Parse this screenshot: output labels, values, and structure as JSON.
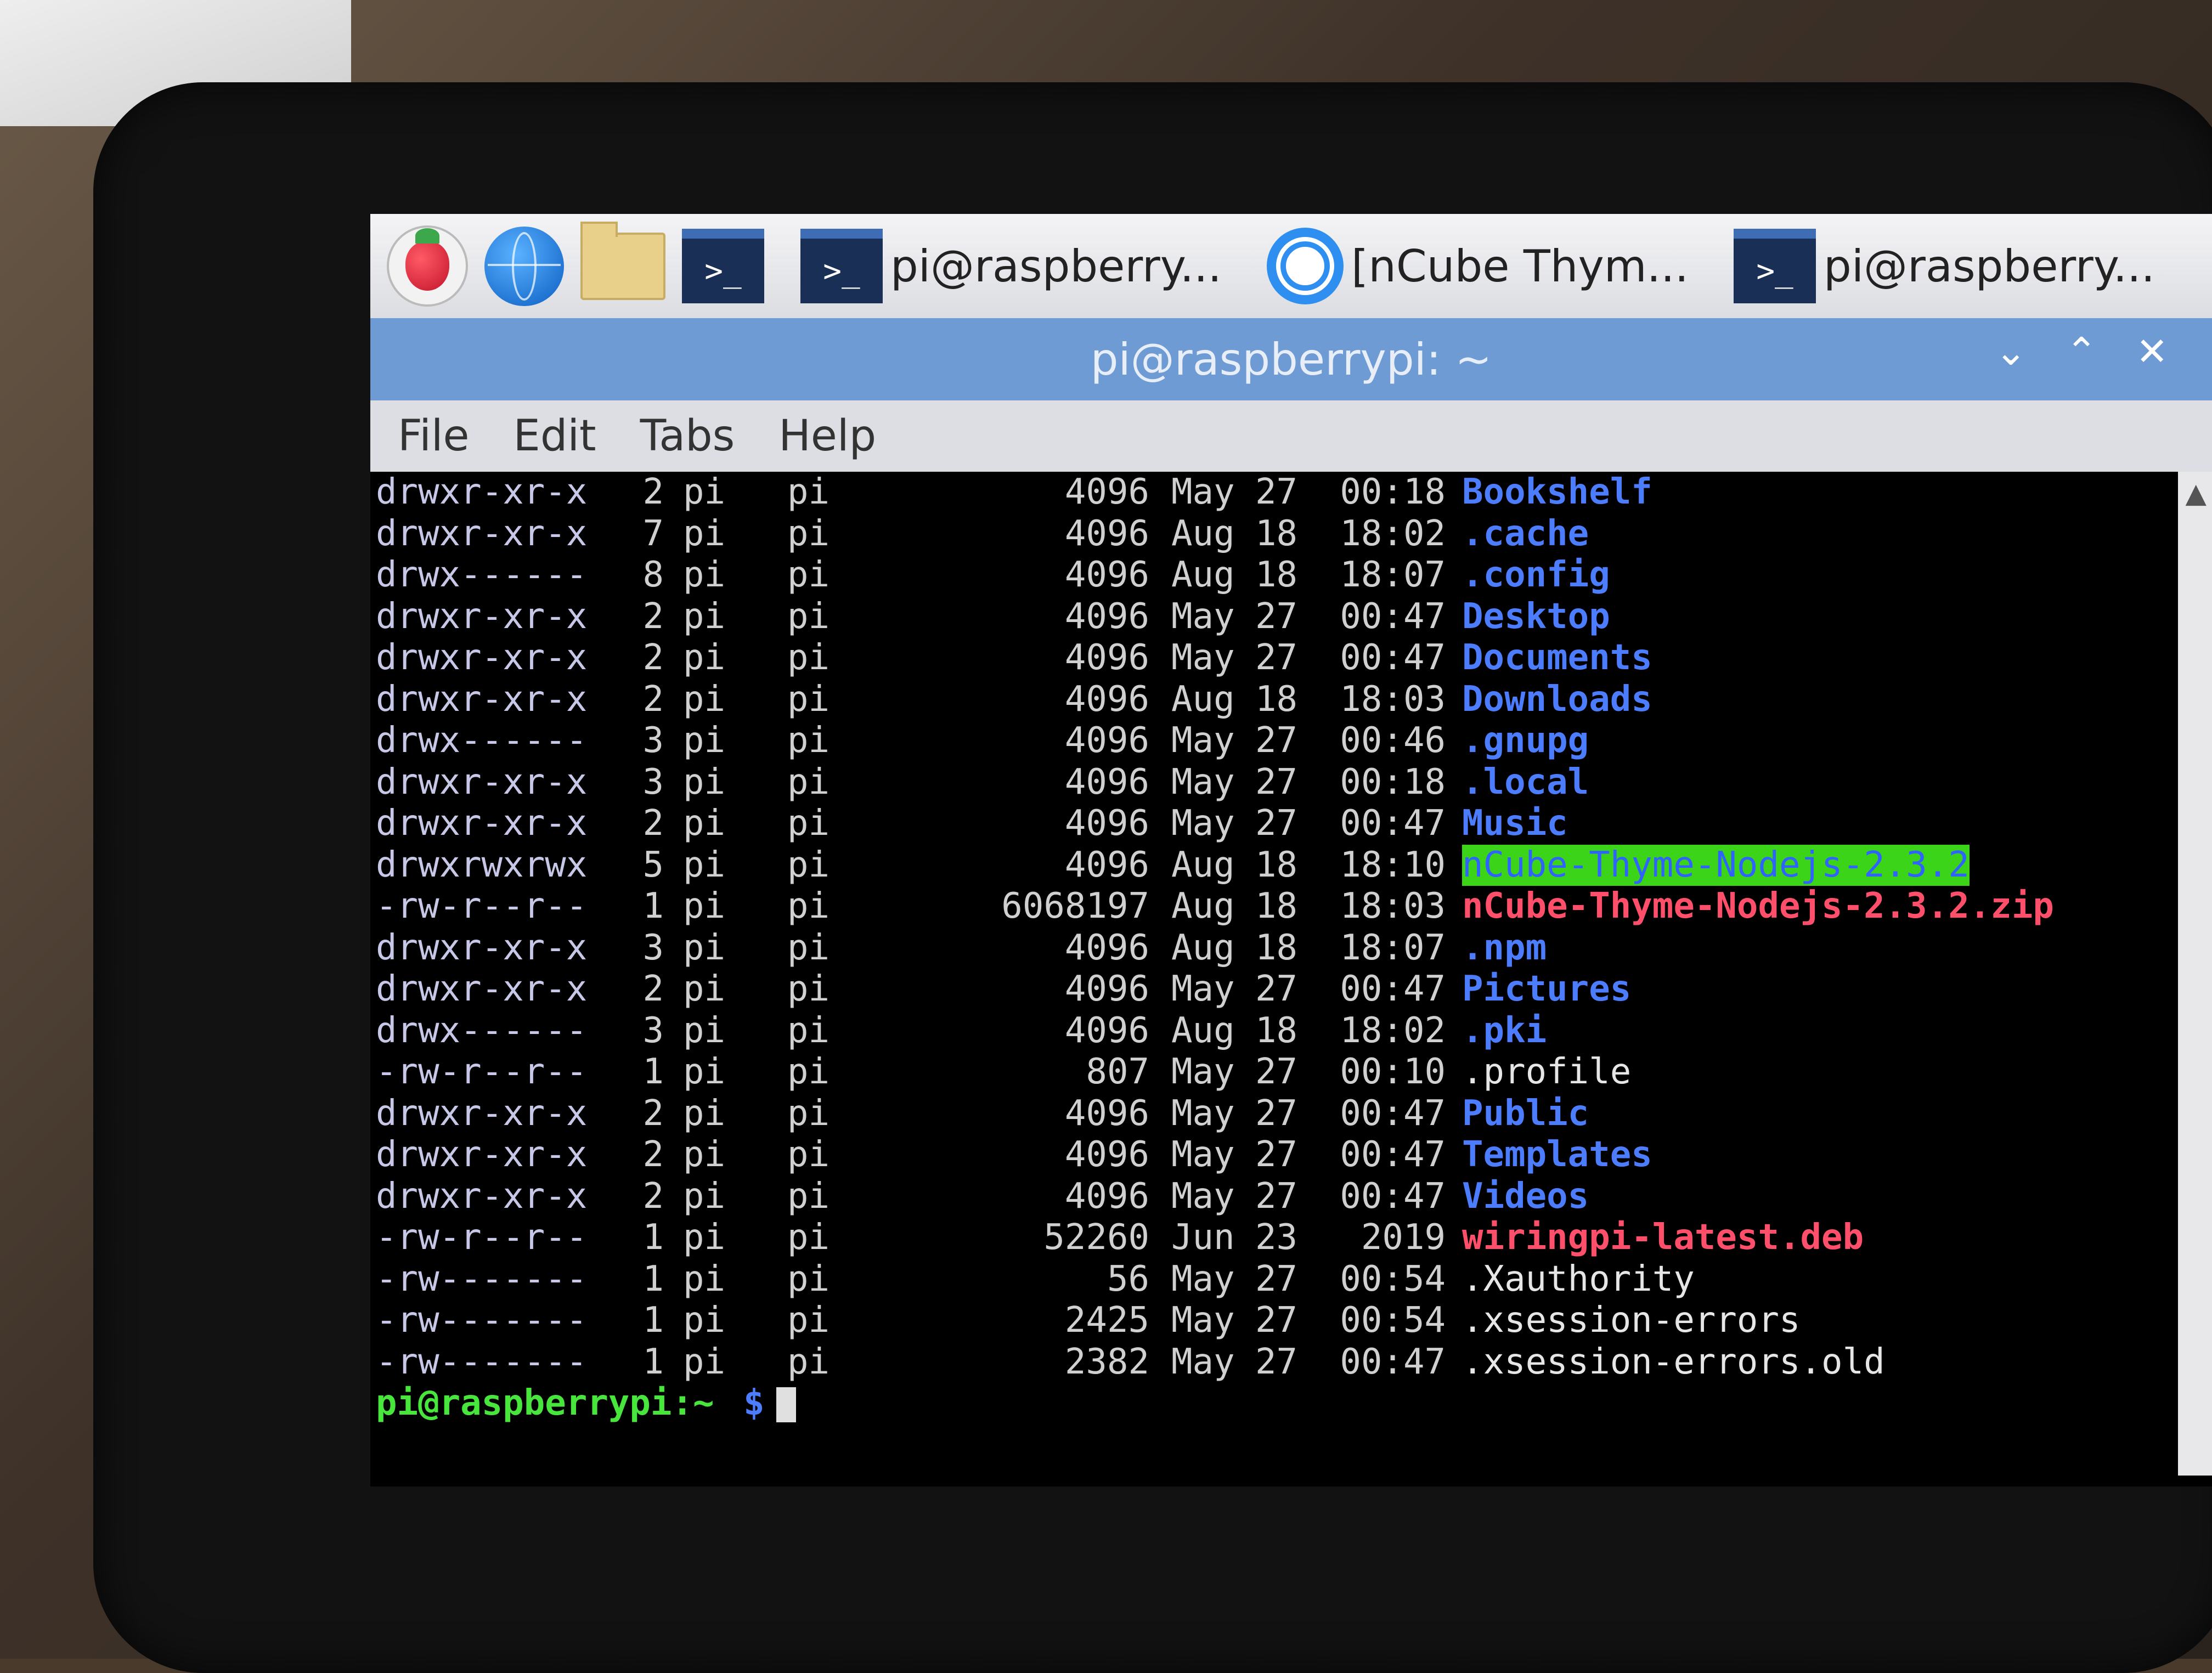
{
  "taskbar": {
    "tasks": [
      {
        "label": "pi@raspberry..."
      },
      {
        "label": "[nCube Thym..."
      },
      {
        "label": "pi@raspberry..."
      }
    ],
    "term_glyph": ">_"
  },
  "window": {
    "title": "pi@raspberrypi: ~",
    "controls": {
      "minimize": "⌄",
      "maximize": "⌃",
      "close": "✕"
    }
  },
  "menu": [
    "File",
    "Edit",
    "Tabs",
    "Help"
  ],
  "listing": [
    {
      "perm": "drwxr-xr-x",
      "links": "2",
      "owner": "pi",
      "group": "pi",
      "size": "4096",
      "month": "May",
      "day": "27",
      "time": "00:18",
      "name": "Bookshelf",
      "type": "dir"
    },
    {
      "perm": "drwxr-xr-x",
      "links": "7",
      "owner": "pi",
      "group": "pi",
      "size": "4096",
      "month": "Aug",
      "day": "18",
      "time": "18:02",
      "name": ".cache",
      "type": "dir"
    },
    {
      "perm": "drwx------",
      "links": "8",
      "owner": "pi",
      "group": "pi",
      "size": "4096",
      "month": "Aug",
      "day": "18",
      "time": "18:07",
      "name": ".config",
      "type": "dir"
    },
    {
      "perm": "drwxr-xr-x",
      "links": "2",
      "owner": "pi",
      "group": "pi",
      "size": "4096",
      "month": "May",
      "day": "27",
      "time": "00:47",
      "name": "Desktop",
      "type": "dir"
    },
    {
      "perm": "drwxr-xr-x",
      "links": "2",
      "owner": "pi",
      "group": "pi",
      "size": "4096",
      "month": "May",
      "day": "27",
      "time": "00:47",
      "name": "Documents",
      "type": "dir"
    },
    {
      "perm": "drwxr-xr-x",
      "links": "2",
      "owner": "pi",
      "group": "pi",
      "size": "4096",
      "month": "Aug",
      "day": "18",
      "time": "18:03",
      "name": "Downloads",
      "type": "dir"
    },
    {
      "perm": "drwx------",
      "links": "3",
      "owner": "pi",
      "group": "pi",
      "size": "4096",
      "month": "May",
      "day": "27",
      "time": "00:46",
      "name": ".gnupg",
      "type": "dir"
    },
    {
      "perm": "drwxr-xr-x",
      "links": "3",
      "owner": "pi",
      "group": "pi",
      "size": "4096",
      "month": "May",
      "day": "27",
      "time": "00:18",
      "name": ".local",
      "type": "dir"
    },
    {
      "perm": "drwxr-xr-x",
      "links": "2",
      "owner": "pi",
      "group": "pi",
      "size": "4096",
      "month": "May",
      "day": "27",
      "time": "00:47",
      "name": "Music",
      "type": "dir"
    },
    {
      "perm": "drwxrwxrwx",
      "links": "5",
      "owner": "pi",
      "group": "pi",
      "size": "4096",
      "month": "Aug",
      "day": "18",
      "time": "18:10",
      "name": "nCube-Thyme-Nodejs-2.3.2",
      "type": "highlight"
    },
    {
      "perm": "-rw-r--r--",
      "links": "1",
      "owner": "pi",
      "group": "pi",
      "size": "6068197",
      "month": "Aug",
      "day": "18",
      "time": "18:03",
      "name": "nCube-Thyme-Nodejs-2.3.2.zip",
      "type": "archive"
    },
    {
      "perm": "drwxr-xr-x",
      "links": "3",
      "owner": "pi",
      "group": "pi",
      "size": "4096",
      "month": "Aug",
      "day": "18",
      "time": "18:07",
      "name": ".npm",
      "type": "dir"
    },
    {
      "perm": "drwxr-xr-x",
      "links": "2",
      "owner": "pi",
      "group": "pi",
      "size": "4096",
      "month": "May",
      "day": "27",
      "time": "00:47",
      "name": "Pictures",
      "type": "dir"
    },
    {
      "perm": "drwx------",
      "links": "3",
      "owner": "pi",
      "group": "pi",
      "size": "4096",
      "month": "Aug",
      "day": "18",
      "time": "18:02",
      "name": ".pki",
      "type": "dir"
    },
    {
      "perm": "-rw-r--r--",
      "links": "1",
      "owner": "pi",
      "group": "pi",
      "size": "807",
      "month": "May",
      "day": "27",
      "time": "00:10",
      "name": ".profile",
      "type": "file"
    },
    {
      "perm": "drwxr-xr-x",
      "links": "2",
      "owner": "pi",
      "group": "pi",
      "size": "4096",
      "month": "May",
      "day": "27",
      "time": "00:47",
      "name": "Public",
      "type": "dir"
    },
    {
      "perm": "drwxr-xr-x",
      "links": "2",
      "owner": "pi",
      "group": "pi",
      "size": "4096",
      "month": "May",
      "day": "27",
      "time": "00:47",
      "name": "Templates",
      "type": "dir"
    },
    {
      "perm": "drwxr-xr-x",
      "links": "2",
      "owner": "pi",
      "group": "pi",
      "size": "4096",
      "month": "May",
      "day": "27",
      "time": "00:47",
      "name": "Videos",
      "type": "dir"
    },
    {
      "perm": "-rw-r--r--",
      "links": "1",
      "owner": "pi",
      "group": "pi",
      "size": "52260",
      "month": "Jun",
      "day": "23",
      "time": "2019",
      "name": "wiringpi-latest.deb",
      "type": "archive"
    },
    {
      "perm": "-rw-------",
      "links": "1",
      "owner": "pi",
      "group": "pi",
      "size": "56",
      "month": "May",
      "day": "27",
      "time": "00:54",
      "name": ".Xauthority",
      "type": "file"
    },
    {
      "perm": "-rw-------",
      "links": "1",
      "owner": "pi",
      "group": "pi",
      "size": "2425",
      "month": "May",
      "day": "27",
      "time": "00:54",
      "name": ".xsession-errors",
      "type": "file"
    },
    {
      "perm": "-rw-------",
      "links": "1",
      "owner": "pi",
      "group": "pi",
      "size": "2382",
      "month": "May",
      "day": "27",
      "time": "00:47",
      "name": ".xsession-errors.old",
      "type": "file"
    }
  ],
  "prompt": {
    "user_host": "pi@raspberrypi:~",
    "symbol": "$"
  },
  "colors": {
    "directory": "#4c7dff",
    "archive": "#ff4f6b",
    "highlight_bg": "#3cd418",
    "prompt": "#48e63c"
  }
}
